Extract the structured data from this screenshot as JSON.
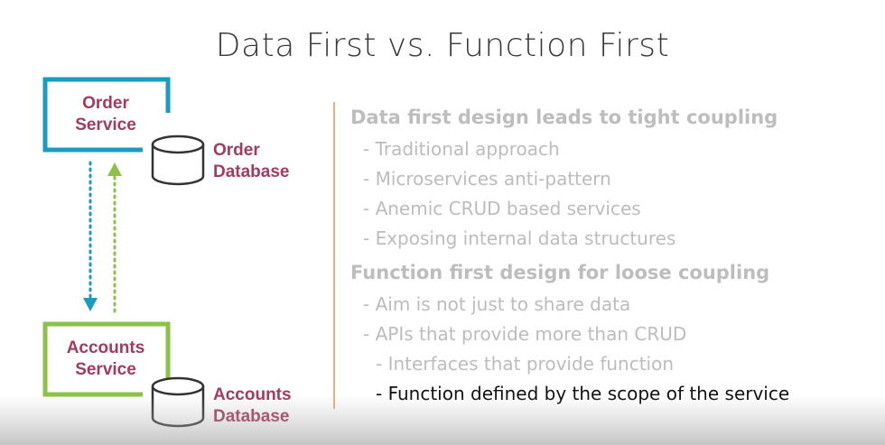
{
  "slide": {
    "title": "Data First vs. Function First"
  },
  "diagram": {
    "order_service": {
      "line1": "Order",
      "line2": "Service",
      "border_color": "#1a9cc0"
    },
    "order_database": {
      "line1": "Order",
      "line2": "Database"
    },
    "accounts_service": {
      "line1": "Accounts",
      "line2": "Service",
      "border_color": "#8dc14a"
    },
    "accounts_database": {
      "line1": "Accounts",
      "line2": "Database"
    },
    "arrow_down_color": "#1a9cc0",
    "arrow_up_color": "#8dc14a",
    "label_color": "#a33b5f"
  },
  "points": [
    {
      "text": "Data first design leads to tight coupling",
      "kind": "heading"
    },
    {
      "text": "- Traditional approach",
      "kind": "sub"
    },
    {
      "text": "- Microservices anti-pattern",
      "kind": "sub"
    },
    {
      "text": "- Anemic CRUD based services",
      "kind": "sub"
    },
    {
      "text": "- Exposing internal data structures",
      "kind": "sub"
    },
    {
      "text": "Function first design for loose coupling",
      "kind": "heading"
    },
    {
      "text": "- Aim is not just to share data",
      "kind": "sub"
    },
    {
      "text": "- APIs that provide more than CRUD",
      "kind": "sub"
    },
    {
      "text": "- Interfaces that provide function",
      "kind": "sub"
    },
    {
      "text": "- Function defined by the scope of the service",
      "kind": "sub-active"
    }
  ]
}
